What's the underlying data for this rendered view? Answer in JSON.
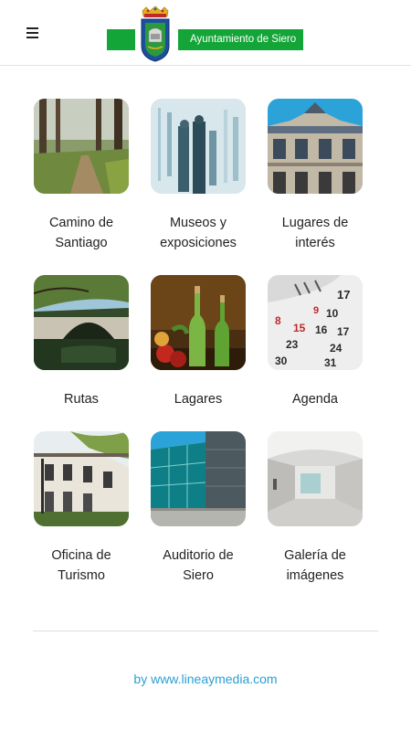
{
  "header": {
    "menu_icon": "hamburger-menu-icon",
    "logo_text": "Ayuntamiento de Siero",
    "brand_color": "#13a538"
  },
  "tiles": [
    {
      "label": "Camino de\nSantiago",
      "image": "forest-path-photo"
    },
    {
      "label": "Museos y\nexposiciones",
      "image": "museum-blur-photo"
    },
    {
      "label": "Lugares de\ninterés",
      "image": "historic-building-photo"
    },
    {
      "label": "Rutas",
      "image": "stone-bridge-photo"
    },
    {
      "label": "Lagares",
      "image": "cider-bottles-photo"
    },
    {
      "label": "Agenda",
      "image": "calendar-photo"
    },
    {
      "label": "Oficina de\nTurismo",
      "image": "tourism-office-photo"
    },
    {
      "label": "Auditorio de\nSiero",
      "image": "auditorium-photo"
    },
    {
      "label": "Galería de\nimágenes",
      "image": "gallery-hall-photo"
    }
  ],
  "footer": {
    "credit": "by www.lineaymedia.com",
    "link_color": "#2a9fd6"
  }
}
